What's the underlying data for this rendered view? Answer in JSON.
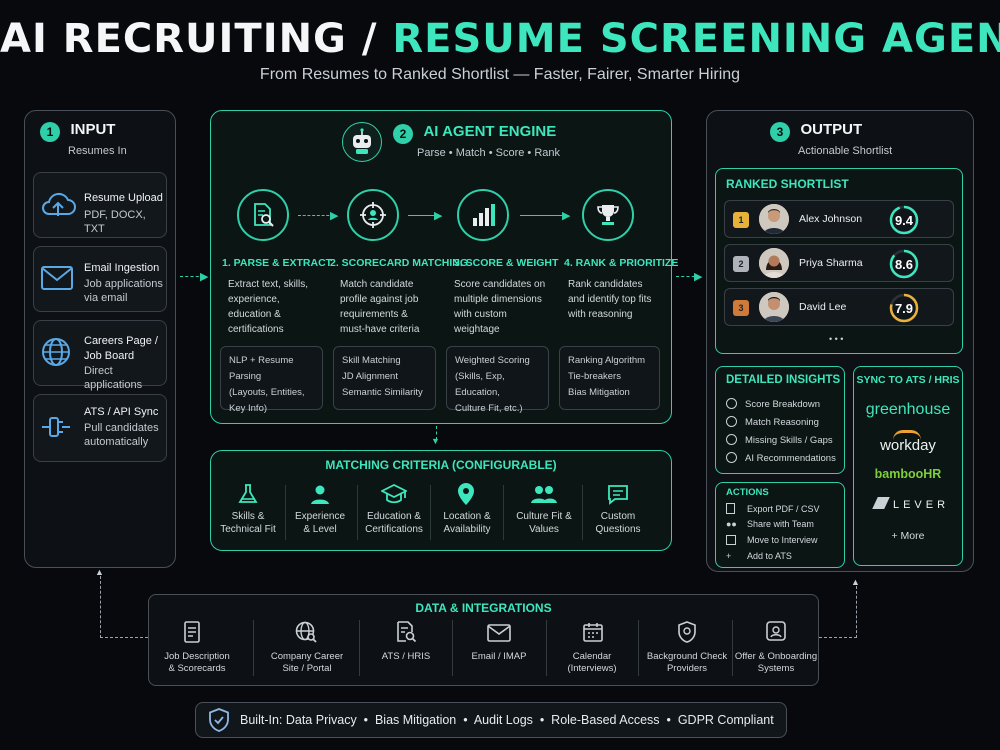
{
  "title": {
    "part1": "AI RECRUITING /",
    "part2": "RESUME SCREENING AGENT"
  },
  "subtitle": "From Resumes to Ranked Shortlist — Faster, Fairer, Smarter Hiring",
  "input": {
    "num": "1",
    "title": "INPUT",
    "subtitle": "Resumes In",
    "items": [
      {
        "title": "Resume Upload",
        "desc": "PDF, DOCX, TXT"
      },
      {
        "title": "Email Ingestion",
        "desc": "Job applications via email"
      },
      {
        "title": "Careers Page / Job Board",
        "desc": "Direct applications"
      },
      {
        "title": "ATS / API Sync",
        "desc": "Pull candidates automatically"
      }
    ]
  },
  "engine": {
    "num": "2",
    "title": "AI AGENT ENGINE",
    "subtitle": "Parse • Match • Score • Rank",
    "steps": [
      {
        "title": "1. PARSE & EXTRACT",
        "desc": "Extract text, skills, experience, education & certifications",
        "tech": [
          "NLP + Resume Parsing",
          "(Layouts, Entities,",
          "Key Info)"
        ]
      },
      {
        "title": "2. SCORECARD MATCHING",
        "desc": "Match candidate profile against job requirements & must-have criteria",
        "tech": [
          "Skill Matching",
          "JD Alignment",
          "Semantic Similarity"
        ]
      },
      {
        "title": "3. SCORE & WEIGHT",
        "desc": "Score candidates on multiple dimensions with custom weightage",
        "tech": [
          "Weighted Scoring",
          "(Skills, Exp, Education,",
          "Culture Fit, etc.)"
        ]
      },
      {
        "title": "4. RANK & PRIORITIZE",
        "desc": "Rank candidates and identify top fits with reasoning",
        "tech": [
          "Ranking Algorithm",
          "Tie-breakers",
          "Bias Mitigation"
        ]
      }
    ]
  },
  "criteria": {
    "title": "MATCHING CRITERIA (CONFIGURABLE)",
    "items": [
      {
        "l1": "Skills &",
        "l2": "Technical Fit"
      },
      {
        "l1": "Experience",
        "l2": "& Level"
      },
      {
        "l1": "Education &",
        "l2": "Certifications"
      },
      {
        "l1": "Location &",
        "l2": "Availability"
      },
      {
        "l1": "Culture Fit &",
        "l2": "Values"
      },
      {
        "l1": "Custom",
        "l2": "Questions"
      }
    ]
  },
  "output": {
    "num": "3",
    "title": "OUTPUT",
    "subtitle": "Actionable Shortlist",
    "shortlist_title": "RANKED SHORTLIST",
    "candidates": [
      {
        "rank": "1",
        "name": "Alex Johnson",
        "score": 9.4
      },
      {
        "rank": "2",
        "name": "Priya Sharma",
        "score": 8.6
      },
      {
        "rank": "3",
        "name": "David Lee",
        "score": 7.9
      }
    ],
    "more": "• • •",
    "insights_title": "DETAILED INSIGHTS",
    "insights": [
      "Score Breakdown",
      "Match Reasoning",
      "Missing Skills / Gaps",
      "AI Recommendations"
    ],
    "actions_title": "ACTIONS",
    "actions": [
      "Export PDF / CSV",
      "Share with Team",
      "Move to Interview",
      "Add to ATS"
    ],
    "sync_title": "SYNC TO ATS / HRIS",
    "sync": [
      "greenhouse",
      "workday",
      "bambooHR",
      "LEVER"
    ],
    "sync_more": "+ More"
  },
  "integrations": {
    "title": "DATA & INTEGRATIONS",
    "items": [
      {
        "l1": "Job Description",
        "l2": "& Scorecards"
      },
      {
        "l1": "Company Career",
        "l2": "Site / Portal"
      },
      {
        "l1": "ATS / HRIS",
        "l2": ""
      },
      {
        "l1": "Email / IMAP",
        "l2": ""
      },
      {
        "l1": "Calendar",
        "l2": "(Interviews)"
      },
      {
        "l1": "Background Check",
        "l2": "Providers"
      },
      {
        "l1": "Offer & Onboarding",
        "l2": "Systems"
      }
    ]
  },
  "footer": "Built-In: Data Privacy  •  Bias Mitigation  •  Audit Logs  •  Role-Based Access  •  GDPR Compliant",
  "colors": {
    "accent": "#3ee6bd",
    "gold": "#e8b23a",
    "silver": "#aeb4ba",
    "bronze": "#d07a3a"
  }
}
